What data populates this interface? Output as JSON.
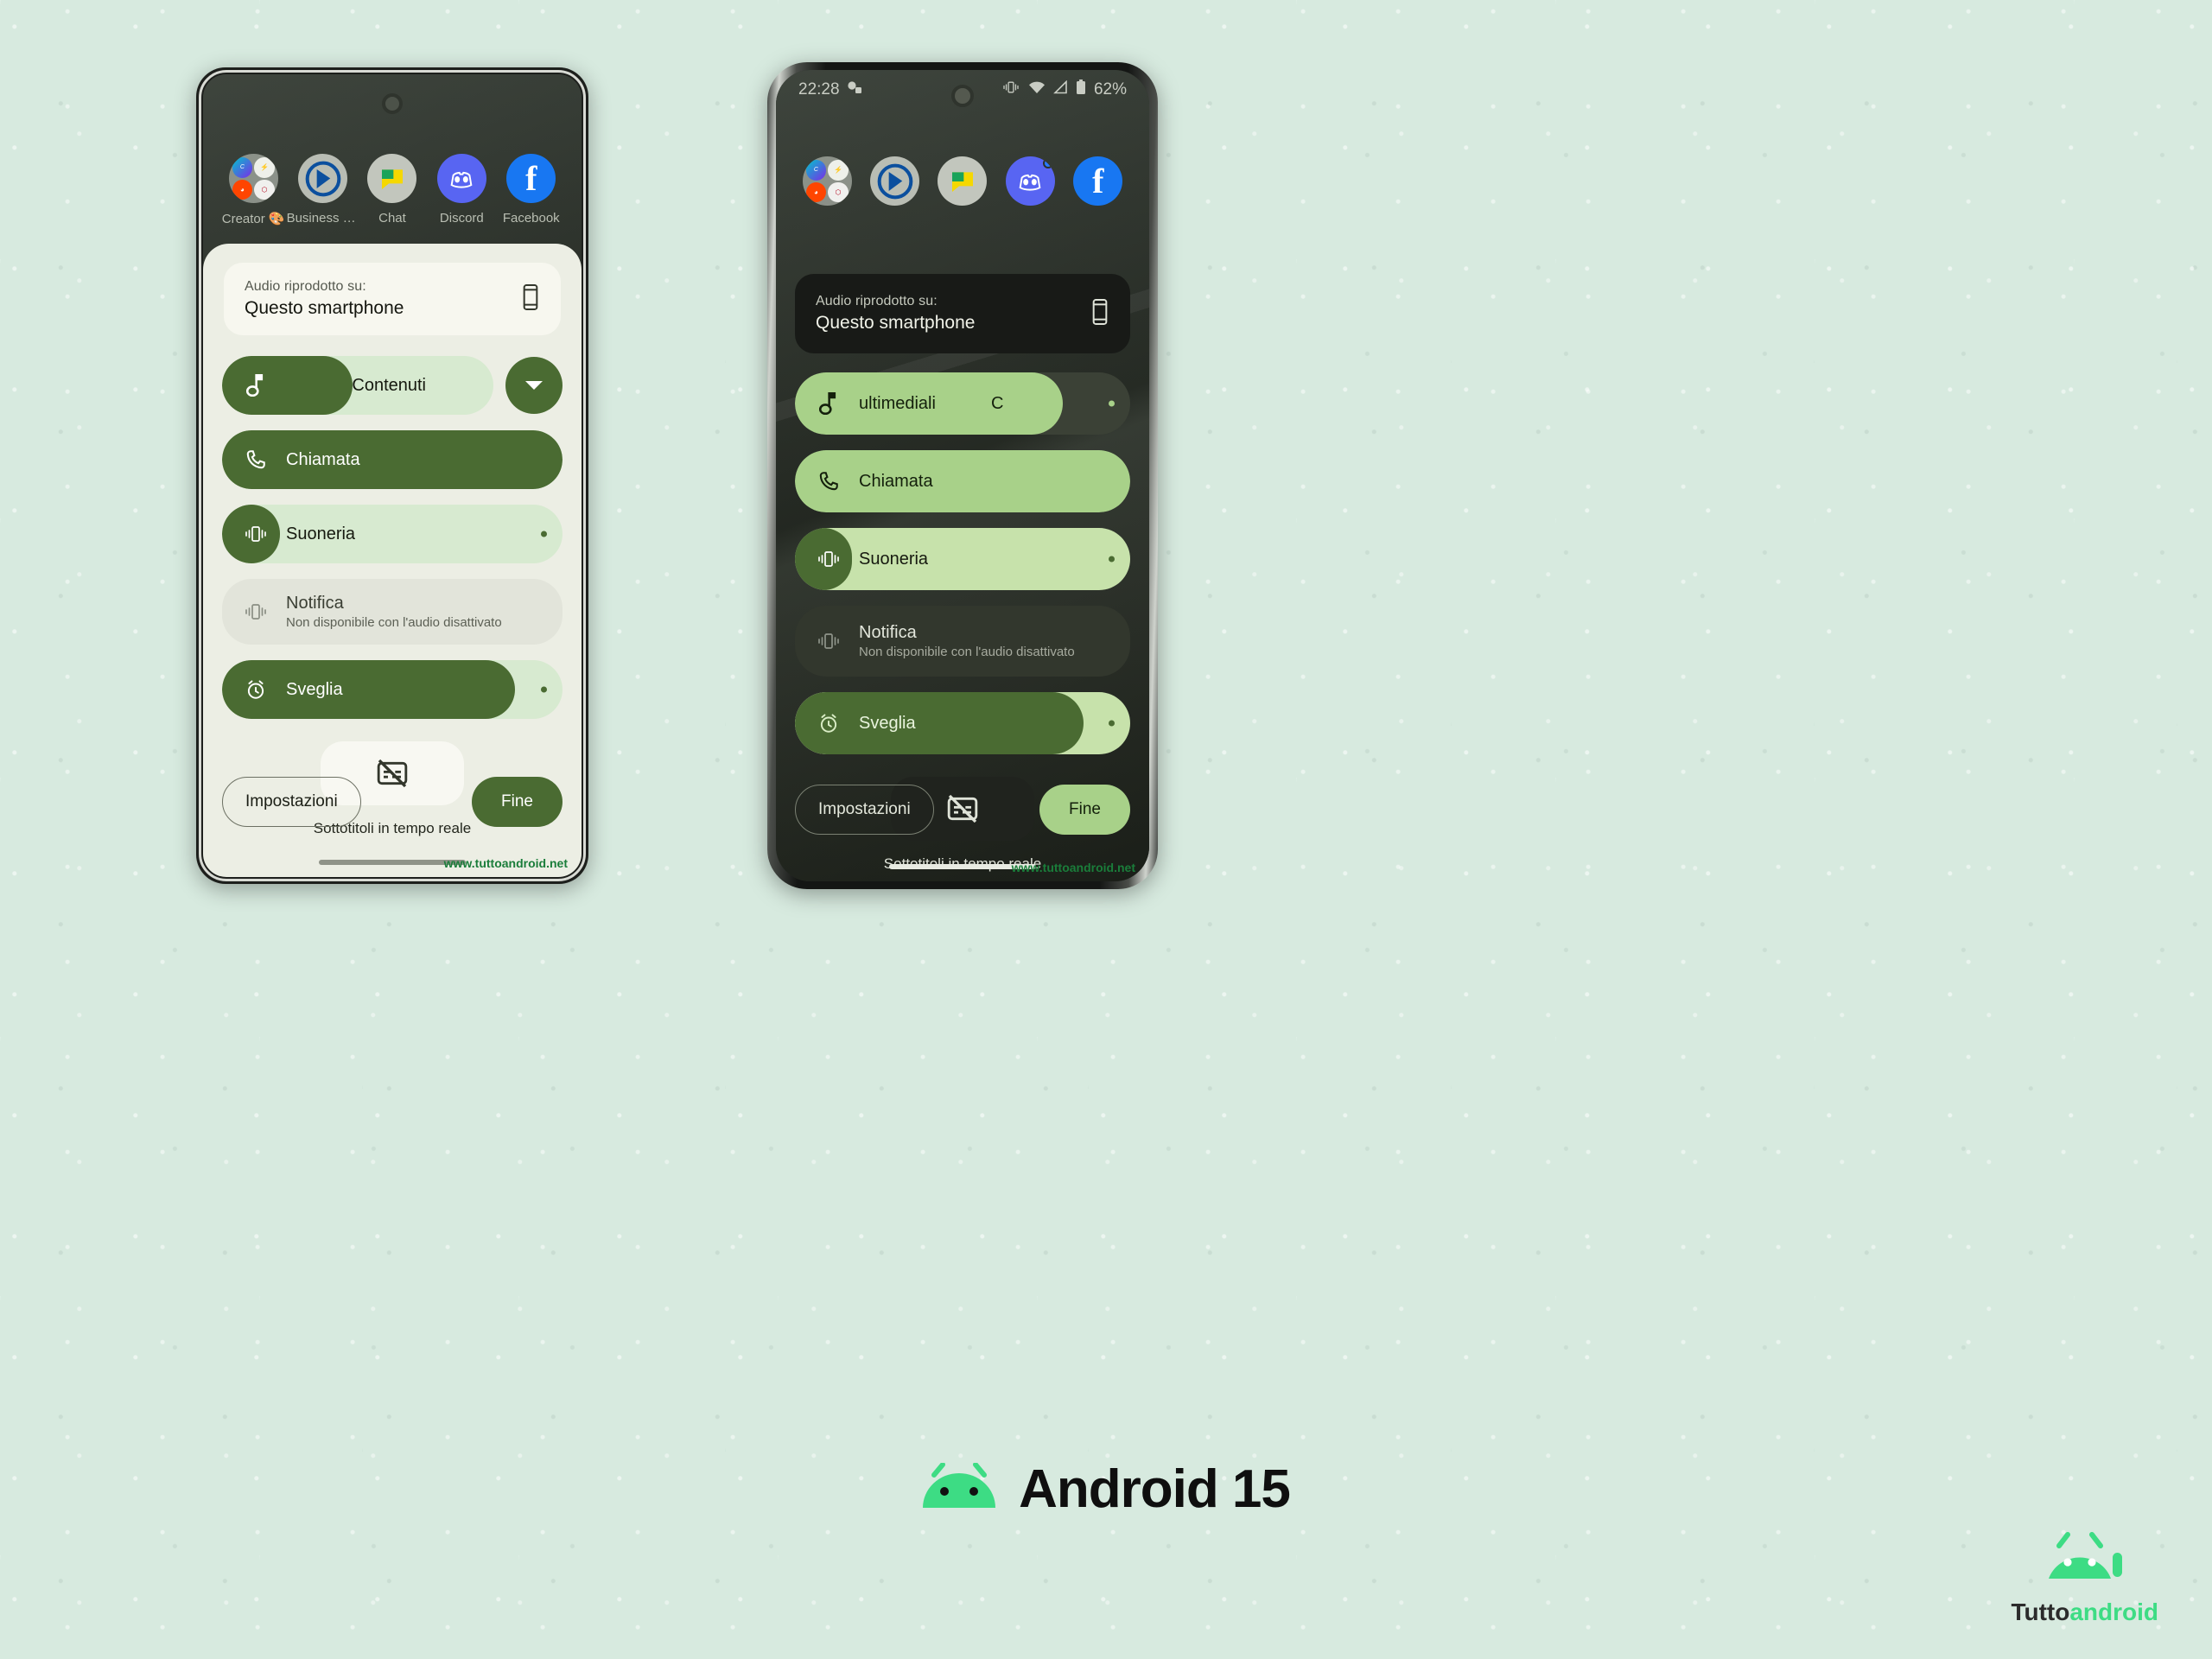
{
  "background": {
    "color": "#d7eadf"
  },
  "brand": {
    "android_label": "Android 15",
    "android_icon": "android-robot-icon",
    "tuttoandroid_prefix": "Tutto",
    "tuttoandroid_suffix": "android",
    "watermark": "www.tuttoandroid.net"
  },
  "phone_left": {
    "theme": "light",
    "apps": [
      {
        "label": "Creator 🎨",
        "icon": "folder-icon"
      },
      {
        "label": "Business S...",
        "icon": "power-bi-icon"
      },
      {
        "label": "Chat",
        "icon": "google-chat-icon"
      },
      {
        "label": "Discord",
        "icon": "discord-icon"
      },
      {
        "label": "Facebook",
        "icon": "facebook-icon"
      }
    ],
    "output": {
      "sub": "Audio riprodotto su:",
      "main": "Questo smartphone",
      "icon": "smartphone-icon"
    },
    "sliders": [
      {
        "id": "media",
        "label": "",
        "icon": "music-note-icon",
        "fill_percent": 48,
        "state": "active",
        "tag": "Contenuti",
        "tag2": "",
        "has_chevron": true,
        "has_dot": false
      },
      {
        "id": "call",
        "label": "Chiamata",
        "icon": "phone-call-icon",
        "fill_percent": 100,
        "state": "active",
        "has_chevron": false,
        "has_dot": false
      },
      {
        "id": "ring",
        "label": "Suoneria",
        "icon": "vibrate-icon",
        "fill_percent": 8,
        "state": "active",
        "has_chevron": false,
        "has_dot": true
      },
      {
        "id": "notification",
        "label": "Notifica",
        "sub": "Non disponibile con l'audio disattivato",
        "icon": "vibrate-icon",
        "fill_percent": 0,
        "state": "disabled",
        "has_chevron": false,
        "has_dot": false
      },
      {
        "id": "alarm",
        "label": "Sveglia",
        "icon": "alarm-clock-icon",
        "fill_percent": 86,
        "state": "active",
        "has_chevron": false,
        "has_dot": true
      }
    ],
    "captions": {
      "label": "Sottotitoli in tempo reale",
      "icon": "captions-off-icon"
    },
    "buttons": {
      "settings": "Impostazioni",
      "done": "Fine"
    }
  },
  "phone_right": {
    "theme": "dark",
    "statusbar": {
      "time": "22:28",
      "left_icons": [
        "notification-glyph-icon"
      ],
      "right_icons": [
        "vibrate-icon",
        "wifi-icon",
        "signal-icon",
        "battery-icon"
      ],
      "battery": "62%"
    },
    "apps": [
      {
        "label": "",
        "icon": "folder-icon"
      },
      {
        "label": "",
        "icon": "power-bi-icon"
      },
      {
        "label": "",
        "icon": "google-chat-icon"
      },
      {
        "label": "",
        "icon": "discord-icon"
      },
      {
        "label": "",
        "icon": "facebook-icon"
      }
    ],
    "output": {
      "sub": "Audio riprodotto su:",
      "main": "Questo smartphone",
      "icon": "smartphone-icon"
    },
    "sliders": [
      {
        "id": "media",
        "label": "",
        "icon": "music-note-icon",
        "fill_percent": 80,
        "state": "active",
        "tag": "ultimediali",
        "tag2": "C",
        "has_chevron": false,
        "has_dot": true
      },
      {
        "id": "call",
        "label": "Chiamata",
        "icon": "phone-call-icon",
        "fill_percent": 100,
        "state": "active",
        "has_chevron": false,
        "has_dot": false
      },
      {
        "id": "ring",
        "label": "Suoneria",
        "icon": "vibrate-icon",
        "fill_percent": 17,
        "state": "active",
        "has_chevron": false,
        "has_dot": true
      },
      {
        "id": "notification",
        "label": "Notifica",
        "sub": "Non disponibile con l'audio disattivato",
        "icon": "vibrate-icon",
        "fill_percent": 0,
        "state": "disabled",
        "has_chevron": false,
        "has_dot": false
      },
      {
        "id": "alarm",
        "label": "Sveglia",
        "icon": "alarm-clock-icon",
        "fill_percent": 86,
        "state": "active",
        "has_chevron": false,
        "has_dot": true
      }
    ],
    "captions": {
      "label": "Sottotitoli in tempo reale",
      "icon": "captions-off-icon"
    },
    "buttons": {
      "settings": "Impostazioni",
      "done": "Fine"
    }
  },
  "colors": {
    "accent_dark_green": "#4a6b32",
    "accent_light_green": "#cfe5b9",
    "android_green": "#3ddc84",
    "panel_light": "#eceee4",
    "panel_dark": "#181a17",
    "watermark_green": "#1a7d3a"
  }
}
